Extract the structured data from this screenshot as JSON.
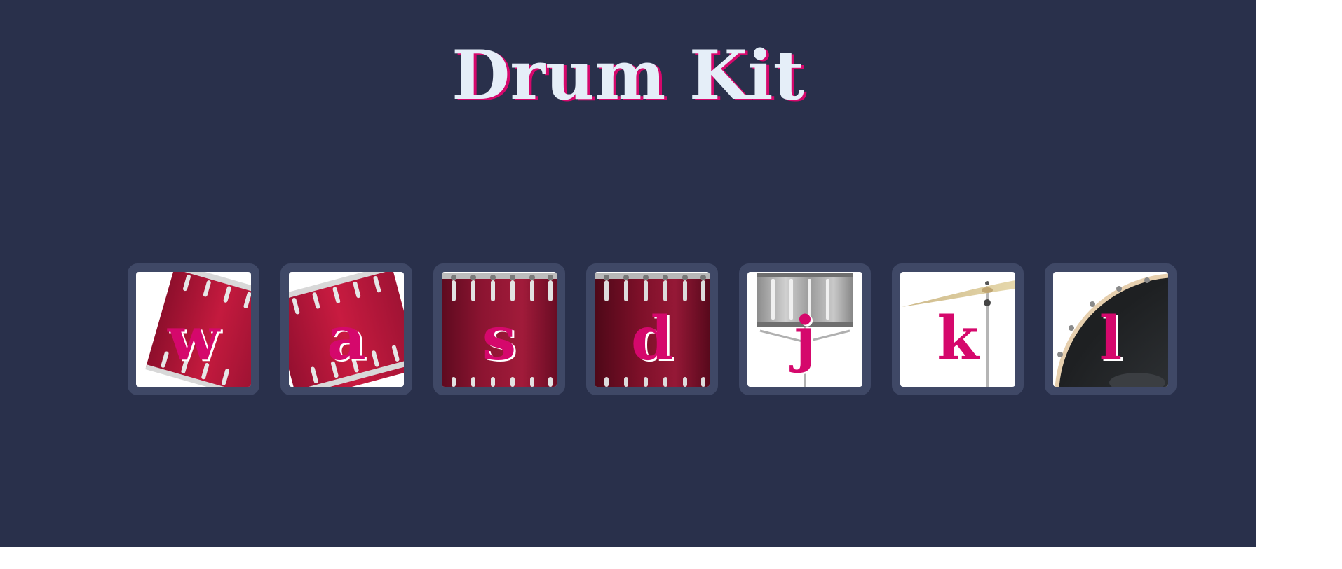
{
  "title": "Drum Kit",
  "colors": {
    "background": "#29304b",
    "accent": "#d5086c",
    "title": "#e5eef8",
    "pad_frame": "#3f4866"
  },
  "pads": [
    {
      "key": "w",
      "icon": "tom-1-icon"
    },
    {
      "key": "a",
      "icon": "tom-2-icon"
    },
    {
      "key": "s",
      "icon": "tom-3-icon"
    },
    {
      "key": "d",
      "icon": "tom-4-icon"
    },
    {
      "key": "j",
      "icon": "snare-icon"
    },
    {
      "key": "k",
      "icon": "crash-cymbal-icon"
    },
    {
      "key": "l",
      "icon": "kick-drum-icon"
    }
  ]
}
